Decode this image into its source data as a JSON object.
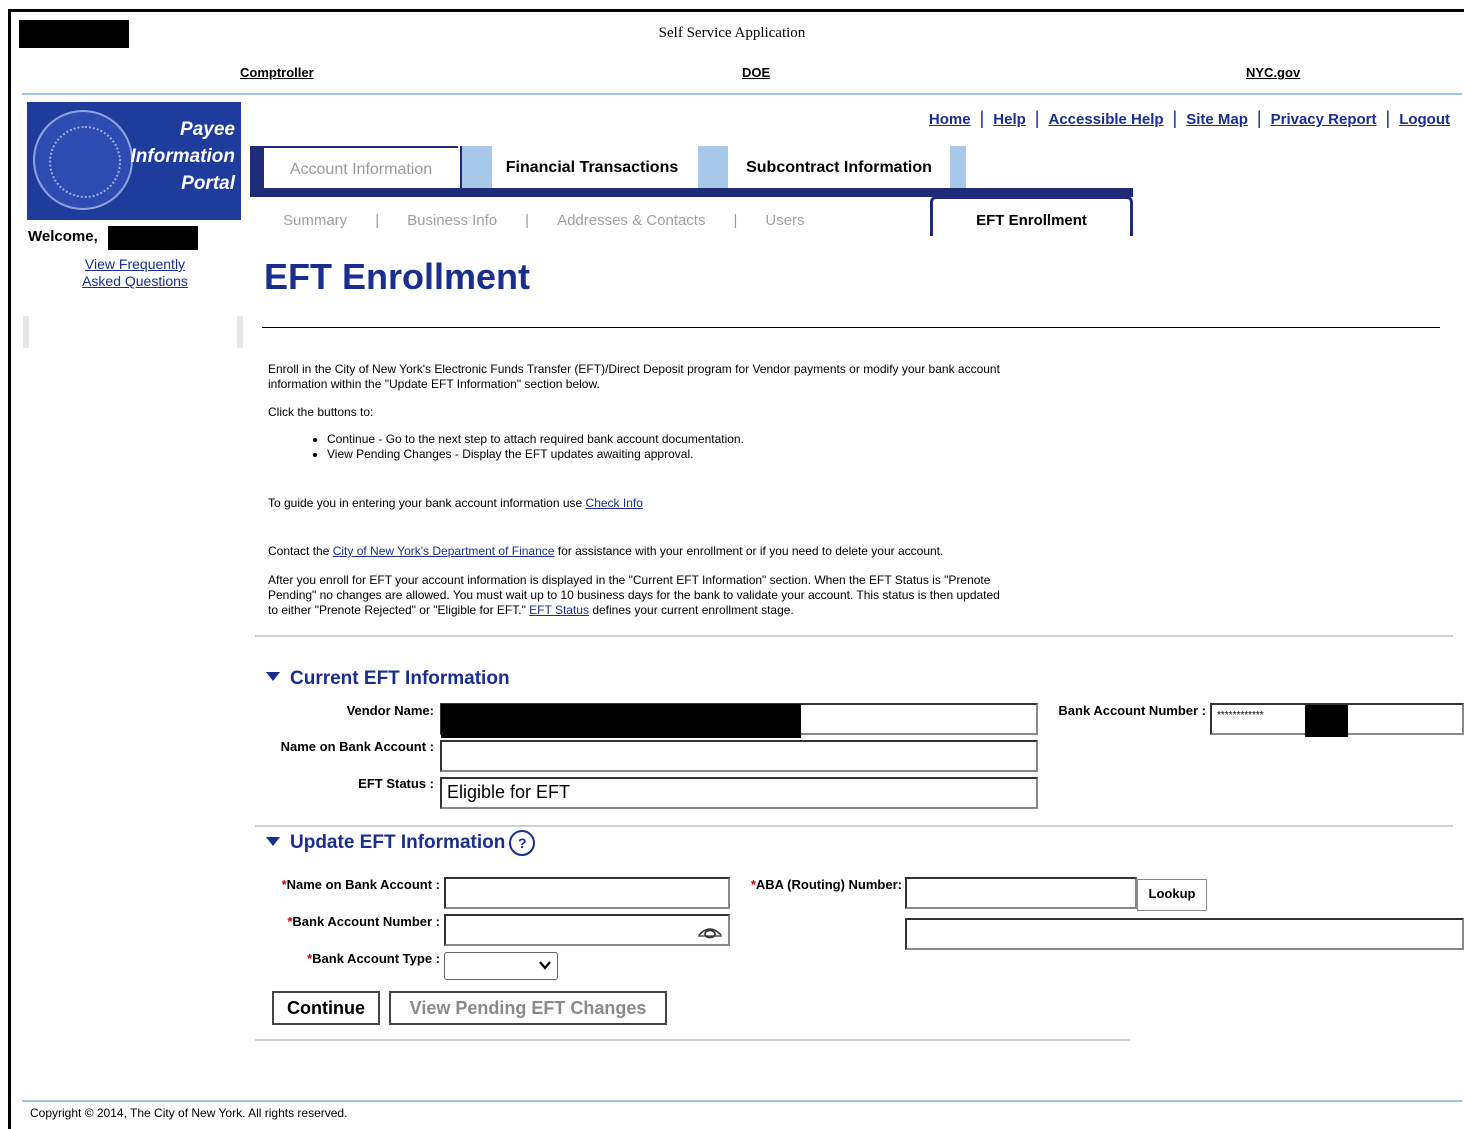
{
  "header": {
    "app_title": "Self Service Application",
    "links": {
      "comptroller": "Comptroller",
      "doe": "DOE",
      "nycgov": "NYC.gov"
    }
  },
  "logo": {
    "line1": "Payee",
    "line2": "Information",
    "line3": "Portal"
  },
  "sidebar": {
    "welcome": "Welcome,",
    "faq_line1": "View Frequently",
    "faq_line2": "Asked Questions"
  },
  "util_nav": [
    "Home",
    "Help",
    "Accessible Help",
    "Site Map",
    "Privacy Report",
    "Logout"
  ],
  "main_tabs": {
    "account": "Account Information",
    "financial": "Financial Transactions",
    "subcontract": "Subcontract Information"
  },
  "sub_tabs": {
    "summary": "Summary",
    "business": "Business Info",
    "addresses": "Addresses & Contacts",
    "users": "Users",
    "eft": "EFT Enrollment"
  },
  "page": {
    "title": "EFT Enrollment",
    "intro_line1": "Enroll in the City of New York's Electronic Funds Transfer (EFT)/Direct Deposit program for Vendor payments or modify your bank account",
    "intro_line2": "information within the \"Update EFT Information\" section below.",
    "click_text": "Click the buttons to:",
    "bullet1": "Continue - Go to the next step to attach required bank account documentation.",
    "bullet2": "View Pending Changes - Display the EFT updates awaiting approval.",
    "guide_text": "To guide you in entering your bank account information use ",
    "guide_link": "Check Info",
    "contact_pre": "Contact the ",
    "contact_link": "City of New York's Department of Finance",
    "contact_post": " for assistance with your enrollment or if you need to delete your account.",
    "after_line1": "After you enroll for EFT your account information is displayed in the \"Current EFT Information\" section. When the EFT Status is \"Prenote",
    "after_line2": "Pending\" no changes are allowed. You must wait up to 10 business days for the bank to validate your account. This status is then updated",
    "after_line3_pre": "to either \"Prenote Rejected\" or \"Eligible for EFT.\" ",
    "after_link": "EFT Status",
    "after_line3_post": " defines your current enrollment stage."
  },
  "current_eft": {
    "heading": "Current EFT Information",
    "vendor_name_label": "Vendor Name:",
    "name_on_account_label": "Name on Bank Account :",
    "eft_status_label": "EFT Status :",
    "eft_status_value": "Eligible for EFT",
    "bank_account_number_label": "Bank Account Number :",
    "bank_account_number_value": "************"
  },
  "update_eft": {
    "heading": "Update EFT Information",
    "help_glyph": "?",
    "required_marker": "*",
    "name_label": "Name on Bank Account :",
    "account_number_label": "Bank Account Number :",
    "account_type_label": "Bank Account Type :",
    "aba_label": "ABA (Routing) Number:",
    "lookup_button": "Lookup",
    "continue_button": "Continue",
    "pending_button": "View Pending EFT Changes"
  },
  "footer": {
    "copyright": "Copyright © 2014, The City of New York. All rights reserved."
  }
}
